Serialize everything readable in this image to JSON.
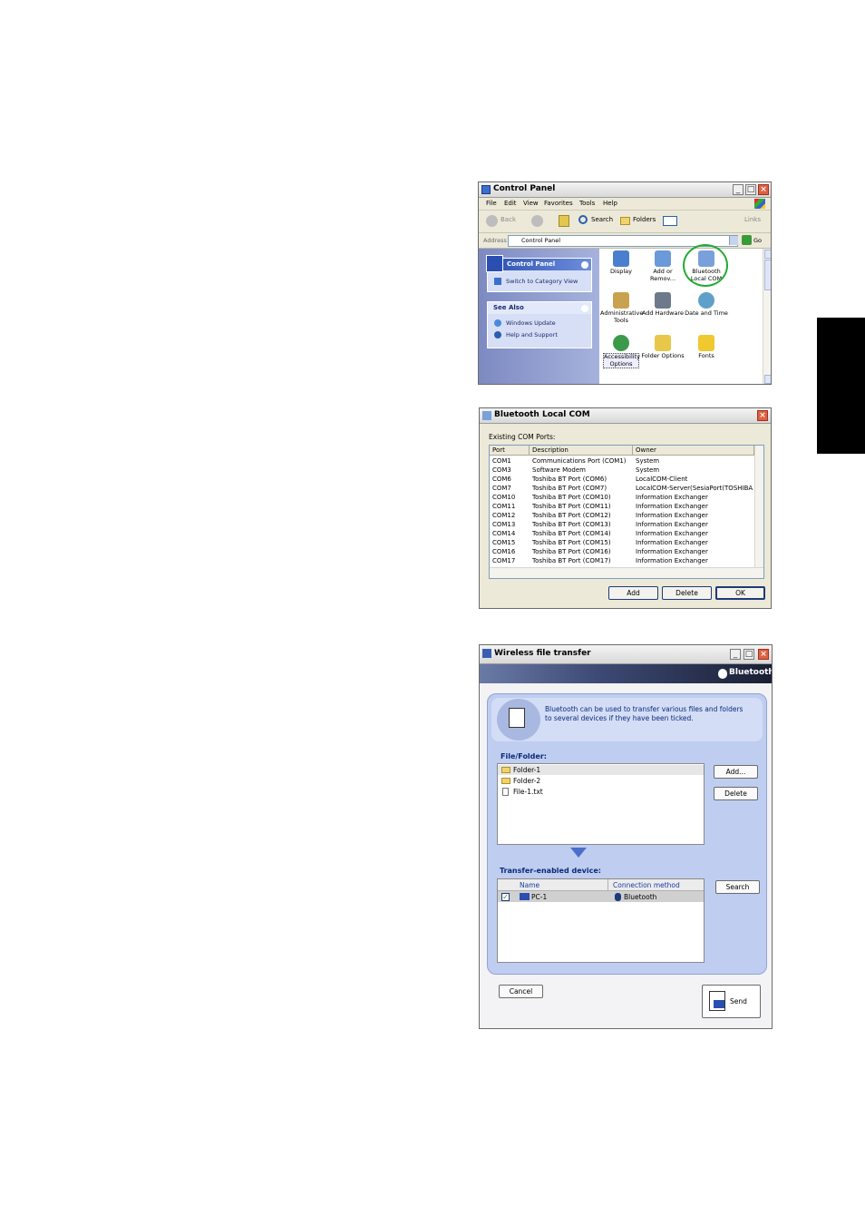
{
  "control_panel": {
    "title": "Control Panel",
    "menu": [
      "File",
      "Edit",
      "View",
      "Favorites",
      "Tools",
      "Help"
    ],
    "toolbar": {
      "back": "Back",
      "search": "Search",
      "folders": "Folders",
      "links": "Links"
    },
    "address": {
      "label": "Address",
      "value": "Control Panel",
      "go": "Go"
    },
    "sidepane": {
      "header": "Control Panel",
      "switch_view": "Switch to Category View",
      "see_also_header": "See Also",
      "see_also": [
        "Windows Update",
        "Help and Support"
      ]
    },
    "icons": [
      {
        "label": "Display",
        "icon": "display-icon"
      },
      {
        "label": "Add or Remov...",
        "icon": "add-remove-icon"
      },
      {
        "label": "Bluetooth Local COM",
        "icon": "bluetooth-com-icon",
        "highlighted": true
      },
      {
        "label": "Administrative Tools",
        "icon": "admin-tools-icon"
      },
      {
        "label": "Add Hardware",
        "icon": "add-hardware-icon"
      },
      {
        "label": "Date and Time",
        "icon": "date-time-icon"
      },
      {
        "label": "Accessibility Options",
        "icon": "accessibility-icon",
        "selected": true
      },
      {
        "label": "Folder Options",
        "icon": "folder-options-icon"
      },
      {
        "label": "Fonts",
        "icon": "fonts-icon"
      }
    ],
    "highlight_color": "#22aa33"
  },
  "bt_com": {
    "title": "Bluetooth Local COM",
    "existing_label": "Existing COM Ports:",
    "columns": [
      "Port",
      "Description",
      "Owner"
    ],
    "rows": [
      [
        "COM1",
        "Communications Port (COM1)",
        "System"
      ],
      [
        "COM3",
        "Software Modem",
        "System"
      ],
      [
        "COM6",
        "Toshiba BT Port (COM6)",
        "LocalCOM-Client"
      ],
      [
        "COM7",
        "Toshiba BT Port (COM7)",
        "LocalCOM-Server(SesiaPort(TOSHIBA"
      ],
      [
        "COM10",
        "Toshiba BT Port (COM10)",
        "Information Exchanger"
      ],
      [
        "COM11",
        "Toshiba BT Port (COM11)",
        "Information Exchanger"
      ],
      [
        "COM12",
        "Toshiba BT Port (COM12)",
        "Information Exchanger"
      ],
      [
        "COM13",
        "Toshiba BT Port (COM13)",
        "Information Exchanger"
      ],
      [
        "COM14",
        "Toshiba BT Port (COM14)",
        "Information Exchanger"
      ],
      [
        "COM15",
        "Toshiba BT Port (COM15)",
        "Information Exchanger"
      ],
      [
        "COM16",
        "Toshiba BT Port (COM16)",
        "Information Exchanger"
      ],
      [
        "COM17",
        "Toshiba BT Port (COM17)",
        "Information Exchanger"
      ]
    ],
    "buttons": {
      "add": "Add",
      "delete": "Delete",
      "ok": "OK"
    }
  },
  "wft": {
    "title": "Wireless file transfer",
    "brand": "Bluetooth",
    "intro": "Bluetooth can be used to transfer various files and folders to several devices if they have been ticked.",
    "file_folder_label": "File/Folder:",
    "files": [
      {
        "name": "Folder-1",
        "type": "folder",
        "selected": true
      },
      {
        "name": "Folder-2",
        "type": "folder"
      },
      {
        "name": "File-1.txt",
        "type": "file"
      }
    ],
    "buttons": {
      "add": "Add...",
      "delete": "Delete",
      "search": "Search",
      "cancel": "Cancel",
      "send": "Send"
    },
    "device_label": "Transfer-enabled device:",
    "device_columns": [
      "Name",
      "Connection method"
    ],
    "devices": [
      {
        "name": "PC-1",
        "method": "Bluetooth",
        "checked": true
      }
    ]
  }
}
